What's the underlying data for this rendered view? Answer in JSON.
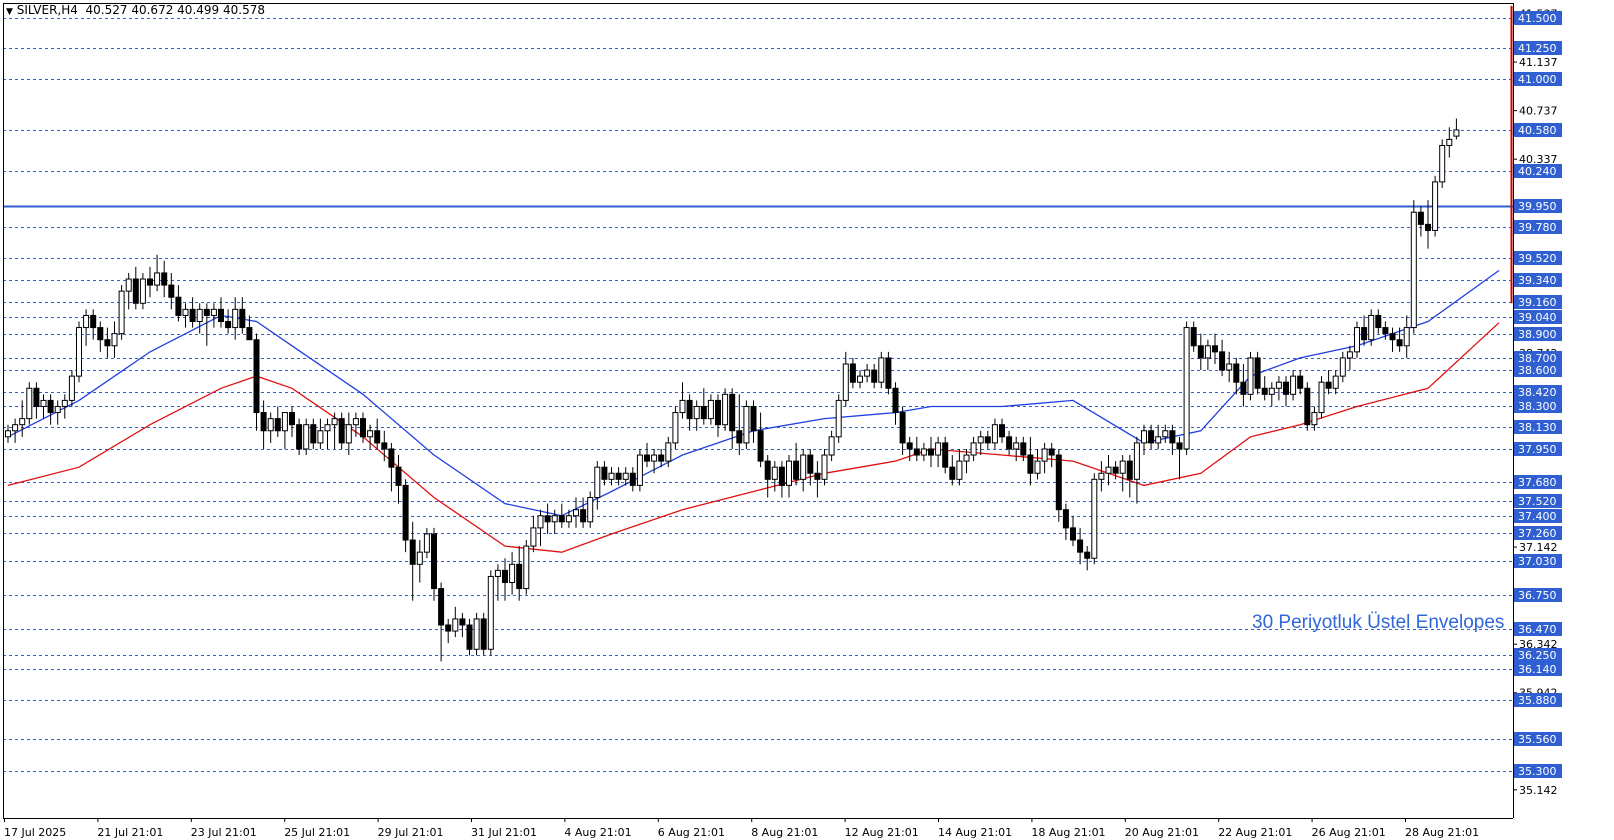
{
  "header": {
    "symbol": "SILVER,H4",
    "open": "40.527",
    "high": "40.672",
    "low": "40.499",
    "close": "40.578"
  },
  "annotation": "30 Periyotluk Üstel Envelopes",
  "chart_data": {
    "type": "candlestick",
    "symbol": "SILVER",
    "timeframe": "H4",
    "y_range": [
      35.0,
      41.6
    ],
    "price_ticks": [
      "41.537",
      "41.137",
      "40.737",
      "40.337",
      "39.942",
      "39.542",
      "39.142",
      "38.742",
      "38.342",
      "37.942",
      "37.542",
      "37.142",
      "36.742",
      "36.342",
      "35.942",
      "35.542",
      "35.142"
    ],
    "level_lines": [
      "41.500",
      "41.250",
      "41.000",
      "40.580",
      "40.240",
      "39.780",
      "39.520",
      "39.340",
      "39.160",
      "39.040",
      "38.900",
      "38.700",
      "38.600",
      "38.420",
      "38.300",
      "38.130",
      "37.950",
      "37.680",
      "37.520",
      "37.400",
      "37.260",
      "37.030",
      "36.750",
      "36.470",
      "36.250",
      "36.140",
      "35.880",
      "35.560",
      "35.300"
    ],
    "key_level": "39.950",
    "x_labels": [
      "17 Jul 2025",
      "21 Jul 21:01",
      "23 Jul 21:01",
      "25 Jul 21:01",
      "29 Jul 21:01",
      "31 Jul 21:01",
      "4 Aug 21:01",
      "6 Aug 21:01",
      "8 Aug 21:01",
      "12 Aug 21:01",
      "14 Aug 21:01",
      "18 Aug 21:01",
      "20 Aug 21:01",
      "22 Aug 21:01",
      "26 Aug 21:01",
      "28 Aug 21:01"
    ],
    "candles": [
      [
        38.05,
        38.15,
        38.0,
        38.1
      ],
      [
        38.1,
        38.2,
        38.0,
        38.15
      ],
      [
        38.15,
        38.35,
        38.05,
        38.2
      ],
      [
        38.2,
        38.5,
        38.15,
        38.45
      ],
      [
        38.45,
        38.5,
        38.2,
        38.3
      ],
      [
        38.3,
        38.4,
        38.2,
        38.35
      ],
      [
        38.35,
        38.4,
        38.15,
        38.25
      ],
      [
        38.25,
        38.35,
        38.15,
        38.3
      ],
      [
        38.3,
        38.4,
        38.2,
        38.35
      ],
      [
        38.35,
        38.6,
        38.3,
        38.55
      ],
      [
        38.55,
        39.0,
        38.5,
        38.95
      ],
      [
        38.95,
        39.1,
        38.8,
        39.05
      ],
      [
        39.05,
        39.1,
        38.85,
        38.95
      ],
      [
        38.95,
        39.0,
        38.75,
        38.85
      ],
      [
        38.85,
        38.95,
        38.7,
        38.8
      ],
      [
        38.8,
        39.0,
        38.7,
        38.9
      ],
      [
        38.9,
        39.3,
        38.85,
        39.25
      ],
      [
        39.25,
        39.4,
        39.1,
        39.35
      ],
      [
        39.35,
        39.45,
        39.1,
        39.15
      ],
      [
        39.15,
        39.4,
        39.1,
        39.35
      ],
      [
        39.35,
        39.45,
        39.2,
        39.3
      ],
      [
        39.3,
        39.55,
        39.25,
        39.4
      ],
      [
        39.4,
        39.5,
        39.2,
        39.3
      ],
      [
        39.3,
        39.4,
        39.1,
        39.2
      ],
      [
        39.2,
        39.3,
        39.0,
        39.05
      ],
      [
        39.05,
        39.15,
        38.95,
        39.1
      ],
      [
        39.1,
        39.2,
        38.95,
        39.0
      ],
      [
        39.0,
        39.15,
        38.9,
        39.1
      ],
      [
        39.1,
        39.15,
        38.8,
        39.05
      ],
      [
        39.05,
        39.15,
        38.95,
        39.1
      ],
      [
        39.1,
        39.2,
        38.95,
        39.0
      ],
      [
        39.0,
        39.1,
        38.9,
        38.95
      ],
      [
        38.95,
        39.2,
        38.85,
        39.1
      ],
      [
        39.1,
        39.2,
        38.9,
        38.95
      ],
      [
        38.95,
        39.05,
        38.9,
        38.85
      ],
      [
        38.85,
        38.9,
        38.1,
        38.25
      ],
      [
        38.25,
        38.35,
        37.95,
        38.1
      ],
      [
        38.1,
        38.25,
        38.0,
        38.2
      ],
      [
        38.2,
        38.3,
        38.05,
        38.1
      ],
      [
        38.1,
        38.25,
        37.95,
        38.25
      ],
      [
        38.25,
        38.3,
        38.05,
        38.15
      ],
      [
        38.15,
        38.2,
        37.9,
        37.95
      ],
      [
        37.95,
        38.2,
        37.9,
        38.15
      ],
      [
        38.15,
        38.2,
        37.95,
        38.0
      ],
      [
        38.0,
        38.2,
        37.95,
        38.1
      ],
      [
        38.1,
        38.2,
        37.95,
        38.15
      ],
      [
        38.15,
        38.25,
        37.95,
        38.2
      ],
      [
        38.2,
        38.25,
        37.95,
        38.0
      ],
      [
        38.0,
        38.25,
        37.9,
        38.15
      ],
      [
        38.15,
        38.25,
        38.05,
        38.2
      ],
      [
        38.2,
        38.25,
        38.0,
        38.05
      ],
      [
        38.05,
        38.15,
        37.95,
        38.1
      ],
      [
        38.1,
        38.2,
        37.95,
        38.0
      ],
      [
        38.0,
        38.1,
        37.85,
        37.95
      ],
      [
        37.95,
        38.0,
        37.6,
        37.8
      ],
      [
        37.8,
        37.9,
        37.5,
        37.65
      ],
      [
        37.65,
        37.7,
        37.1,
        37.2
      ],
      [
        37.2,
        37.35,
        36.7,
        37.0
      ],
      [
        37.0,
        37.2,
        36.85,
        37.1
      ],
      [
        37.1,
        37.3,
        37.05,
        37.25
      ],
      [
        37.25,
        37.3,
        36.7,
        36.8
      ],
      [
        36.8,
        36.85,
        36.2,
        36.5
      ],
      [
        36.5,
        36.55,
        36.35,
        36.45
      ],
      [
        36.45,
        36.65,
        36.4,
        36.55
      ],
      [
        36.55,
        36.6,
        36.4,
        36.5
      ],
      [
        36.5,
        36.55,
        36.25,
        36.3
      ],
      [
        36.3,
        36.6,
        36.25,
        36.55
      ],
      [
        36.55,
        36.6,
        36.25,
        36.3
      ],
      [
        36.3,
        36.95,
        36.25,
        36.9
      ],
      [
        36.9,
        37.0,
        36.7,
        36.95
      ],
      [
        36.95,
        37.05,
        36.7,
        36.85
      ],
      [
        36.85,
        37.1,
        36.75,
        37.0
      ],
      [
        37.0,
        37.15,
        36.7,
        36.8
      ],
      [
        36.8,
        37.2,
        36.75,
        37.15
      ],
      [
        37.15,
        37.4,
        37.1,
        37.3
      ],
      [
        37.3,
        37.45,
        37.15,
        37.4
      ],
      [
        37.4,
        37.5,
        37.25,
        37.35
      ],
      [
        37.35,
        37.45,
        37.25,
        37.4
      ],
      [
        37.4,
        37.5,
        37.3,
        37.35
      ],
      [
        37.35,
        37.45,
        37.3,
        37.4
      ],
      [
        37.4,
        37.55,
        37.3,
        37.45
      ],
      [
        37.45,
        37.55,
        37.3,
        37.35
      ],
      [
        37.35,
        37.6,
        37.3,
        37.55
      ],
      [
        37.55,
        37.85,
        37.45,
        37.8
      ],
      [
        37.8,
        37.85,
        37.65,
        37.7
      ],
      [
        37.7,
        37.8,
        37.65,
        37.75
      ],
      [
        37.75,
        37.8,
        37.65,
        37.7
      ],
      [
        37.7,
        37.8,
        37.65,
        37.75
      ],
      [
        37.75,
        37.8,
        37.6,
        37.65
      ],
      [
        37.65,
        37.95,
        37.6,
        37.9
      ],
      [
        37.9,
        38.0,
        37.8,
        37.85
      ],
      [
        37.85,
        37.95,
        37.75,
        37.9
      ],
      [
        37.9,
        37.95,
        37.8,
        37.85
      ],
      [
        37.85,
        38.05,
        37.8,
        38.0
      ],
      [
        38.0,
        38.3,
        37.95,
        38.25
      ],
      [
        38.25,
        38.5,
        38.2,
        38.35
      ],
      [
        38.35,
        38.4,
        38.1,
        38.2
      ],
      [
        38.2,
        38.35,
        38.1,
        38.3
      ],
      [
        38.3,
        38.45,
        38.15,
        38.2
      ],
      [
        38.2,
        38.4,
        38.15,
        38.35
      ],
      [
        38.35,
        38.4,
        38.05,
        38.15
      ],
      [
        38.15,
        38.45,
        38.1,
        38.4
      ],
      [
        38.4,
        38.45,
        37.95,
        38.1
      ],
      [
        38.1,
        38.4,
        37.9,
        38.0
      ],
      [
        38.0,
        38.35,
        37.95,
        38.3
      ],
      [
        38.3,
        38.35,
        38.0,
        38.1
      ],
      [
        38.1,
        38.25,
        37.8,
        37.85
      ],
      [
        37.85,
        37.9,
        37.55,
        37.7
      ],
      [
        37.7,
        37.85,
        37.6,
        37.8
      ],
      [
        37.8,
        37.85,
        37.55,
        37.65
      ],
      [
        37.65,
        37.9,
        37.55,
        37.85
      ],
      [
        37.85,
        38.0,
        37.65,
        37.7
      ],
      [
        37.7,
        37.95,
        37.6,
        37.9
      ],
      [
        37.9,
        37.95,
        37.65,
        37.75
      ],
      [
        37.75,
        37.85,
        37.55,
        37.7
      ],
      [
        37.7,
        37.95,
        37.65,
        37.9
      ],
      [
        37.9,
        38.1,
        37.85,
        38.05
      ],
      [
        38.05,
        38.4,
        38.0,
        38.35
      ],
      [
        38.35,
        38.75,
        38.3,
        38.65
      ],
      [
        38.65,
        38.7,
        38.45,
        38.5
      ],
      [
        38.5,
        38.6,
        38.45,
        38.55
      ],
      [
        38.55,
        38.65,
        38.5,
        38.6
      ],
      [
        38.6,
        38.65,
        38.45,
        38.5
      ],
      [
        38.5,
        38.75,
        38.45,
        38.7
      ],
      [
        38.7,
        38.75,
        38.4,
        38.45
      ],
      [
        38.45,
        38.5,
        38.15,
        38.25
      ],
      [
        38.25,
        38.3,
        37.9,
        38.0
      ],
      [
        38.0,
        38.05,
        37.85,
        37.95
      ],
      [
        37.95,
        38.05,
        37.85,
        37.9
      ],
      [
        37.9,
        38.0,
        37.85,
        37.95
      ],
      [
        37.95,
        38.05,
        37.8,
        37.9
      ],
      [
        37.9,
        38.05,
        37.8,
        38.0
      ],
      [
        38.0,
        38.05,
        37.75,
        37.8
      ],
      [
        37.8,
        37.9,
        37.65,
        37.7
      ],
      [
        37.7,
        37.95,
        37.65,
        37.85
      ],
      [
        37.85,
        37.95,
        37.75,
        37.9
      ],
      [
        37.9,
        38.05,
        37.85,
        38.0
      ],
      [
        38.0,
        38.1,
        37.9,
        38.05
      ],
      [
        38.05,
        38.1,
        37.95,
        38.0
      ],
      [
        38.0,
        38.2,
        37.95,
        38.15
      ],
      [
        38.15,
        38.2,
        38.0,
        38.05
      ],
      [
        38.05,
        38.1,
        37.9,
        37.95
      ],
      [
        37.95,
        38.05,
        37.85,
        38.0
      ],
      [
        38.0,
        38.05,
        37.85,
        37.9
      ],
      [
        37.9,
        38.05,
        37.65,
        37.75
      ],
      [
        37.75,
        37.95,
        37.7,
        37.85
      ],
      [
        37.85,
        38.0,
        37.75,
        37.95
      ],
      [
        37.95,
        38.0,
        37.8,
        37.9
      ],
      [
        37.9,
        37.95,
        37.35,
        37.45
      ],
      [
        37.45,
        37.5,
        37.2,
        37.3
      ],
      [
        37.3,
        37.4,
        37.15,
        37.2
      ],
      [
        37.2,
        37.3,
        37.0,
        37.1
      ],
      [
        37.1,
        37.15,
        36.95,
        37.05
      ],
      [
        37.05,
        37.75,
        37.0,
        37.7
      ],
      [
        37.7,
        37.85,
        37.6,
        37.75
      ],
      [
        37.75,
        37.9,
        37.65,
        37.8
      ],
      [
        37.8,
        37.85,
        37.7,
        37.75
      ],
      [
        37.75,
        37.9,
        37.6,
        37.85
      ],
      [
        37.85,
        37.9,
        37.55,
        37.7
      ],
      [
        37.7,
        38.05,
        37.5,
        38.0
      ],
      [
        38.0,
        38.15,
        37.9,
        38.1
      ],
      [
        38.1,
        38.15,
        37.95,
        38.0
      ],
      [
        38.0,
        38.15,
        37.95,
        38.05
      ],
      [
        38.05,
        38.15,
        38.0,
        38.1
      ],
      [
        38.1,
        38.15,
        37.9,
        38.0
      ],
      [
        38.0,
        38.05,
        37.7,
        37.95
      ],
      [
        37.95,
        39.0,
        37.9,
        38.95
      ],
      [
        38.95,
        39.0,
        38.75,
        38.8
      ],
      [
        38.8,
        38.9,
        38.6,
        38.7
      ],
      [
        38.7,
        38.85,
        38.6,
        38.8
      ],
      [
        38.8,
        38.9,
        38.65,
        38.75
      ],
      [
        38.75,
        38.85,
        38.55,
        38.6
      ],
      [
        38.6,
        38.75,
        38.5,
        38.65
      ],
      [
        38.65,
        38.7,
        38.4,
        38.5
      ],
      [
        38.5,
        38.65,
        38.3,
        38.4
      ],
      [
        38.4,
        38.75,
        38.35,
        38.7
      ],
      [
        38.7,
        38.75,
        38.4,
        38.45
      ],
      [
        38.45,
        38.55,
        38.35,
        38.4
      ],
      [
        38.4,
        38.5,
        38.3,
        38.45
      ],
      [
        38.45,
        38.55,
        38.35,
        38.5
      ],
      [
        38.5,
        38.55,
        38.3,
        38.4
      ],
      [
        38.4,
        38.6,
        38.35,
        38.55
      ],
      [
        38.55,
        38.6,
        38.4,
        38.45
      ],
      [
        38.45,
        38.5,
        38.1,
        38.15
      ],
      [
        38.15,
        38.3,
        38.1,
        38.25
      ],
      [
        38.25,
        38.55,
        38.2,
        38.5
      ],
      [
        38.5,
        38.6,
        38.4,
        38.45
      ],
      [
        38.45,
        38.6,
        38.4,
        38.55
      ],
      [
        38.55,
        38.75,
        38.5,
        38.7
      ],
      [
        38.7,
        38.8,
        38.6,
        38.75
      ],
      [
        38.75,
        39.0,
        38.7,
        38.95
      ],
      [
        38.95,
        39.05,
        38.8,
        38.85
      ],
      [
        38.85,
        39.1,
        38.8,
        39.05
      ],
      [
        39.05,
        39.1,
        38.9,
        38.95
      ],
      [
        38.95,
        39.0,
        38.85,
        38.9
      ],
      [
        38.9,
        38.95,
        38.75,
        38.85
      ],
      [
        38.85,
        38.95,
        38.75,
        38.8
      ],
      [
        38.8,
        39.05,
        38.7,
        38.95
      ],
      [
        38.95,
        40.0,
        38.9,
        39.9
      ],
      [
        39.9,
        39.95,
        39.7,
        39.8
      ],
      [
        39.8,
        40.0,
        39.6,
        39.75
      ],
      [
        39.75,
        40.2,
        39.7,
        40.15
      ],
      [
        40.15,
        40.5,
        40.1,
        40.45
      ],
      [
        40.45,
        40.6,
        40.35,
        40.5
      ],
      [
        40.527,
        40.672,
        40.499,
        40.578
      ]
    ],
    "moving_average_blue": [
      [
        0,
        38.05
      ],
      [
        10,
        38.35
      ],
      [
        20,
        38.75
      ],
      [
        30,
        39.05
      ],
      [
        35,
        39.0
      ],
      [
        40,
        38.8
      ],
      [
        50,
        38.4
      ],
      [
        60,
        37.9
      ],
      [
        70,
        37.5
      ],
      [
        78,
        37.4
      ],
      [
        85,
        37.6
      ],
      [
        95,
        37.9
      ],
      [
        105,
        38.1
      ],
      [
        115,
        38.2
      ],
      [
        125,
        38.25
      ],
      [
        130,
        38.3
      ],
      [
        140,
        38.3
      ],
      [
        150,
        38.35
      ],
      [
        160,
        38.0
      ],
      [
        168,
        38.1
      ],
      [
        175,
        38.55
      ],
      [
        182,
        38.7
      ],
      [
        190,
        38.8
      ],
      [
        200,
        39.0
      ],
      [
        210,
        39.42
      ]
    ],
    "moving_average_red": [
      [
        0,
        37.65
      ],
      [
        10,
        37.8
      ],
      [
        20,
        38.15
      ],
      [
        30,
        38.45
      ],
      [
        35,
        38.55
      ],
      [
        40,
        38.45
      ],
      [
        50,
        38.05
      ],
      [
        60,
        37.55
      ],
      [
        70,
        37.15
      ],
      [
        78,
        37.1
      ],
      [
        85,
        37.25
      ],
      [
        95,
        37.45
      ],
      [
        105,
        37.6
      ],
      [
        115,
        37.75
      ],
      [
        125,
        37.85
      ],
      [
        130,
        37.95
      ],
      [
        140,
        37.9
      ],
      [
        150,
        37.85
      ],
      [
        160,
        37.65
      ],
      [
        168,
        37.75
      ],
      [
        175,
        38.05
      ],
      [
        182,
        38.15
      ],
      [
        190,
        38.3
      ],
      [
        200,
        38.45
      ],
      [
        210,
        38.99
      ]
    ]
  }
}
